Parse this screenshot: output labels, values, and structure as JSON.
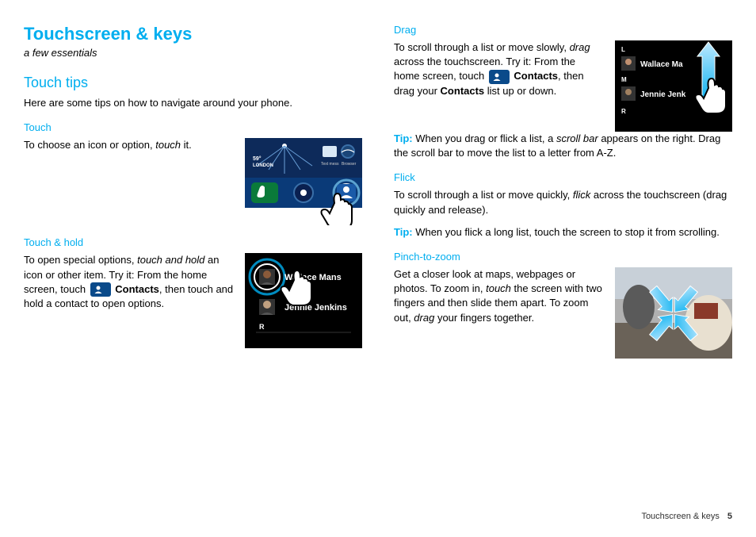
{
  "title": "Touchscreen & keys",
  "subtitle": "a few essentials",
  "section1": {
    "heading": "Touch tips",
    "intro": "Here are some tips on how to navigate around your phone."
  },
  "touch": {
    "heading": "Touch",
    "body_pre": "To choose an icon or option, ",
    "body_em": "touch",
    "body_post": " it.",
    "fig": {
      "temp": "59°",
      "city": "LONDON",
      "label1": "Text mess",
      "label2": "Browser"
    }
  },
  "hold": {
    "heading": "Touch & hold",
    "p1": "To open special options, ",
    "p1_em": "touch and hold",
    "p1_mid": " an icon or other item. Try it: From the home screen, touch ",
    "contacts": "Contacts",
    "p1_post": ", then touch and hold a contact to open options.",
    "fig": {
      "name1": "Wallace Mans",
      "name2": "Jennie Jenkins",
      "letter": "R"
    }
  },
  "drag": {
    "heading": "Drag",
    "p1": "To scroll through a list or move slowly, ",
    "p1_em": "drag",
    "p1_mid": " across the touchscreen. Try it: From the home screen, touch ",
    "contacts": "Contacts",
    "p1_mid2": ", then drag your ",
    "p1_bold": "Contacts",
    "p1_post": " list up or down.",
    "tip_label": "Tip:",
    "tip_pre": " When you drag or flick a list, a ",
    "tip_em": "scroll bar",
    "tip_post": " appears on the right. Drag the scroll bar to move the list to a letter from A-Z.",
    "fig": {
      "L": "L",
      "M": "M",
      "R": "R",
      "name1": "Wallace Ma",
      "name2": "Jennie Jenk"
    }
  },
  "flick": {
    "heading": "Flick",
    "p1_pre": "To scroll through a list or move quickly, ",
    "p1_em": "flick",
    "p1_post": " across the touchscreen (drag quickly and release).",
    "tip_label": "Tip:",
    "tip": " When you flick a long list, touch the screen to stop it from scrolling."
  },
  "pinch": {
    "heading": "Pinch-to-zoom",
    "p1_pre": "Get a closer look at maps, webpages or photos. To zoom in, ",
    "p1_em": "touch",
    "p1_mid": " the screen with two fingers and then slide them apart. To zoom out, ",
    "p1_em2": "drag",
    "p1_post": " your fingers together."
  },
  "footer": {
    "text": "Touchscreen & keys",
    "page": "5"
  }
}
